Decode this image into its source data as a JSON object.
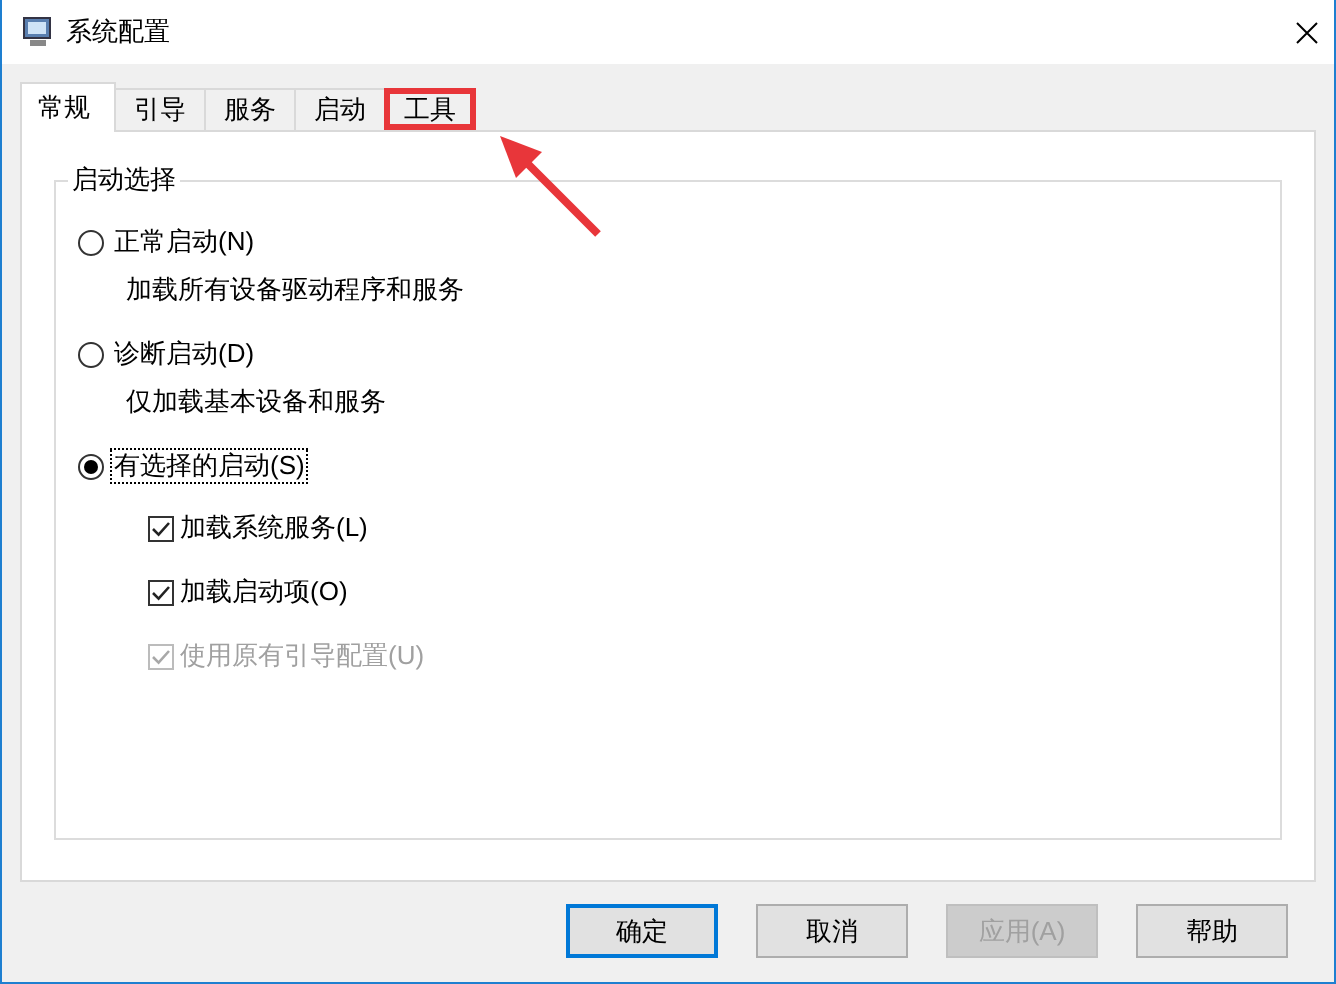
{
  "window": {
    "title": "系统配置"
  },
  "tabs": [
    {
      "label": "常规",
      "selected": true,
      "highlighted": false
    },
    {
      "label": "引导",
      "selected": false,
      "highlighted": false
    },
    {
      "label": "服务",
      "selected": false,
      "highlighted": false
    },
    {
      "label": "启动",
      "selected": false,
      "highlighted": false
    },
    {
      "label": "工具",
      "selected": false,
      "highlighted": true
    }
  ],
  "annotation": {
    "arrow": true
  },
  "group": {
    "title": "启动选择",
    "options": [
      {
        "label": "正常启动(N)",
        "selected": false,
        "focused": false,
        "description": "加载所有设备驱动程序和服务"
      },
      {
        "label": "诊断启动(D)",
        "selected": false,
        "focused": false,
        "description": "仅加载基本设备和服务"
      },
      {
        "label": "有选择的启动(S)",
        "selected": true,
        "focused": true,
        "suboptions": [
          {
            "label": "加载系统服务(L)",
            "checked": true,
            "disabled": false
          },
          {
            "label": "加载启动项(O)",
            "checked": true,
            "disabled": false
          },
          {
            "label": "使用原有引导配置(U)",
            "checked": true,
            "disabled": true
          }
        ]
      }
    ]
  },
  "buttons": [
    {
      "label": "确定",
      "default": true,
      "disabled": false
    },
    {
      "label": "取消",
      "default": false,
      "disabled": false
    },
    {
      "label": "应用(A)",
      "default": false,
      "disabled": true
    },
    {
      "label": "帮助",
      "default": false,
      "disabled": false
    }
  ]
}
